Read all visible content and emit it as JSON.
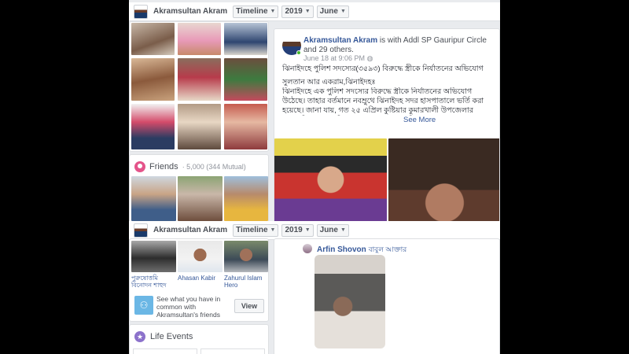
{
  "timeline_bar": {
    "user_name": "Akramsultan Akram",
    "section": "Timeline",
    "year": "2019",
    "month": "June"
  },
  "post1": {
    "author": "Akramsultan Akram",
    "with_text": "is with Addl SP Gauripur Circle and 29 others.",
    "time": "June 18 at 9:06 PM",
    "headline": "ঝিনাইদহে পুলিশ সদস্যের(৩৫৯৩) বিরুদ্ধে স্ত্রীকে নির্যাতনের অভিযোগ",
    "byline": "সুলতান আর একরাম,ঝিনাইদহঃ",
    "paragraph": "ঝিনাইদহে এক পুলিশ সদস্যের বিরুদ্ধে স্ত্রীকে নির্যাতনের অভিযোগ উঠেছে। তাহার বর্তমানে নবম্রুথে ঝিনাইদহ সদর হাসপাতালে ভর্তি করা হয়েছে। জানা যায়, গত ২৫ এপ্রিল কুষ্টিয়ার কুমারখালী উপজেলার শেরকান্দি গ্রামের মতিয়ার রহমানের ছেলে পুলিশ সদস্য শাহজাহান রহমান শোভনের সাথে পারিবারিক ভাবে বিয়ে হয় ঝিনাইদহের শৈলকুপা উপজেলার উমেদপুর গ্রামের জাহিদুল ইসলাম সাদ্দু মিয়ার মেয়ে শাহিনা খাতুনের। বর্তমানে শোভন ঝিনাইদ...",
    "see_more": "See More"
  },
  "friends": {
    "title": "Friends",
    "count": "· 5,000 (344 Mutual)"
  },
  "friend_captions": [
    "পুরুষোত্তমি বিনোদন শাহুদ",
    "Ahasan Kabir",
    "Zahurul Islam Hero"
  ],
  "mutual_box": {
    "text": "See what you have in common with Akramsultan's friends",
    "button": "View"
  },
  "life_events": {
    "title": "Life Events"
  },
  "post2": {
    "author": "Arfin Shovon",
    "author_suffix": "বাবুল আক্তার"
  },
  "colors": {
    "brand_blue": "#365899",
    "background": "#e9ebee",
    "online_green": "#42b72a"
  }
}
